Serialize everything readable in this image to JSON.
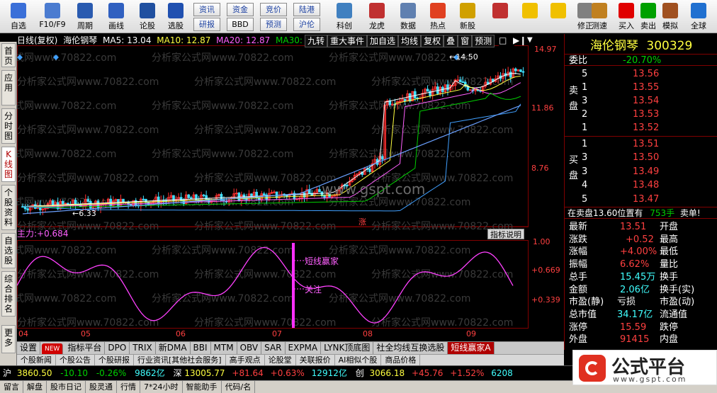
{
  "toolbar": {
    "buttons": [
      {
        "label": "自选",
        "icon": "star-icon",
        "color": "#3a6fd8"
      },
      {
        "label": "F10/F9",
        "icon": "info-icon",
        "color": "#4a7bd0"
      },
      {
        "label": "周期",
        "icon": "clock-icon",
        "color": "#2a5bb0"
      },
      {
        "label": "画线",
        "icon": "pencil-icon",
        "color": "#3060c0"
      },
      {
        "label": "论股",
        "icon": "forum-icon",
        "color": "#2050a0"
      },
      {
        "label": "选股",
        "icon": "stock-picker-icon",
        "color": "#2050b0"
      },
      {
        "label": "科创",
        "icon": "scitech-icon",
        "color": "#4080c0"
      },
      {
        "label": "龙虎",
        "icon": "dragon-icon",
        "color": "#c03030"
      },
      {
        "label": "数据",
        "icon": "data-icon",
        "color": "#6080b0"
      },
      {
        "label": "热点",
        "icon": "hot-icon",
        "color": "#e04020"
      },
      {
        "label": "新股",
        "icon": "ipo-icon",
        "color": "#d0a000"
      },
      {
        "label": "",
        "icon": "color-grid-icon",
        "color": "#c03030"
      },
      {
        "label": "",
        "icon": "back-arrow-icon",
        "color": "#f0c000"
      },
      {
        "label": "",
        "icon": "forward-arrow-icon",
        "color": "#f0c000"
      },
      {
        "label": "修正",
        "icon": "clock-correct-icon",
        "color": "#808080"
      },
      {
        "label": "测速",
        "icon": "speed-test-icon",
        "color": "#c08020"
      },
      {
        "label": "买入",
        "icon": "buy-icon",
        "color": "#e00000"
      },
      {
        "label": "卖出",
        "icon": "sell-icon",
        "color": "#00a000"
      },
      {
        "label": "模拟",
        "icon": "hammer-icon",
        "color": "#a05020"
      },
      {
        "label": "全球",
        "icon": "globe-icon",
        "color": "#2070d0"
      }
    ],
    "small_buttons": [
      "资讯",
      "资金",
      "竞价",
      "陆港",
      "研报",
      "BBD",
      "预测",
      "沪伦"
    ]
  },
  "left_tabs": [
    "首页",
    "应用",
    "分时图",
    "K线图",
    "个股资料",
    "自选股",
    "综合排名",
    "更多"
  ],
  "chart": {
    "header": {
      "period": "日线(复权)",
      "name": "海伦钢琴",
      "ma5": "MA5: 13.04",
      "ma10": "MA10: 12.87",
      "ma20": "MA20: 12.87",
      "ma30": "MA30:"
    },
    "header_buttons": [
      "九转",
      "重大事件",
      "加自选",
      "均线",
      "复权",
      "叠",
      "窗",
      "预测"
    ],
    "price_ticks": [
      "14.97",
      "11.86",
      "8.76"
    ],
    "high_label": "14.50",
    "low_label": "6.33",
    "zhang_label": "涨",
    "watermark_text": "分析家公式网www.70822.com",
    "site_text": "www.gspt.com",
    "indicator": {
      "label": "主力:",
      "value": "+0.684",
      "explain": "指标说明",
      "ticks": [
        "1.00",
        "+0.669",
        "+0.339"
      ],
      "annot1": "短线赢家",
      "annot2": "关注"
    },
    "months": [
      "04",
      "05",
      "06",
      "07",
      "08",
      "09"
    ]
  },
  "bottom_tabs": [
    "设置",
    "NEW",
    "指标平台",
    "DPO",
    "TRIX",
    "新DMA",
    "BBI",
    "MTM",
    "OBV",
    "SAR",
    "EXPMA",
    "LYNK顶底图",
    "社全均线互换选股",
    "短线赢家A"
  ],
  "news_row": [
    "个股新闻",
    "个股公告",
    "个股研报",
    "行业资讯[其他社会服务]",
    "高手观点",
    "论股堂",
    "关联报价",
    "AI相似个股",
    "商品价格"
  ],
  "right": {
    "stock_name": "海伦钢琴",
    "stock_code": "300329",
    "weibi_label": "委比",
    "weibi_value": "-20.70%",
    "sell_label": "卖盘",
    "buy_label": "买盘",
    "sell": [
      {
        "lvl": "5",
        "price": "13.56"
      },
      {
        "lvl": "1",
        "price": "13.55"
      },
      {
        "lvl": "3",
        "price": "13.54"
      },
      {
        "lvl": "2",
        "price": "13.53"
      },
      {
        "lvl": "1",
        "price": "13.52"
      }
    ],
    "buy": [
      {
        "lvl": "1",
        "price": "13.51"
      },
      {
        "lvl": "3",
        "price": "13.50"
      },
      {
        "lvl": "3",
        "price": "13.49"
      },
      {
        "lvl": "4",
        "price": "13.48"
      },
      {
        "lvl": "5",
        "price": "13.47"
      }
    ],
    "pos_text": "在卖盘13.60位置有",
    "pos_vol": "753手",
    "pos_tail": "卖单!",
    "stats": [
      {
        "l": "最新",
        "v": "13.51",
        "l2": "开盘",
        "v2": ""
      },
      {
        "l": "涨跌",
        "v": "+0.52",
        "l2": "最高",
        "v2": ""
      },
      {
        "l": "涨幅",
        "v": "+4.00%",
        "l2": "最低",
        "v2": ""
      },
      {
        "l": "振幅",
        "v": "6.62%",
        "l2": "量比",
        "v2": ""
      },
      {
        "l": "总手",
        "v": "15.45万",
        "l2": "换手",
        "v2": ""
      },
      {
        "l": "金额",
        "v": "2.06亿",
        "l2": "换手(实)",
        "v2": ""
      },
      {
        "l": "市盈(静)",
        "v": "亏损",
        "l2": "市盈(动)",
        "v2": ""
      },
      {
        "l": "总市值",
        "v": "34.17亿",
        "l2": "流通值",
        "v2": ""
      },
      {
        "l": "涨停",
        "v": "15.59",
        "l2": "跌停",
        "v2": ""
      },
      {
        "l": "外盘",
        "v": "91415",
        "l2": "内盘",
        "v2": ""
      }
    ]
  },
  "index_bar": {
    "sh_label": "沪",
    "sh_val": "3860.50",
    "sh_chg": "-10.10",
    "sh_pct": "-0.26%",
    "sh_amt": "9862亿",
    "sz_label": "深",
    "sz_val": "13005.77",
    "sz_chg": "+81.64",
    "sz_pct": "+0.63%",
    "sz_amt": "12912亿",
    "cy_label": "创",
    "cy_val": "3066.18",
    "cy_chg": "+45.76",
    "cy_pct": "+1.52%",
    "cy_amt": "6208"
  },
  "status": [
    "留言",
    "解盘",
    "股市日记",
    "股灵通",
    "行情",
    "7*24小时",
    "智能助手",
    "代码/名"
  ],
  "logo_text": "公式平台",
  "logo_url": "www.gspt.com"
}
